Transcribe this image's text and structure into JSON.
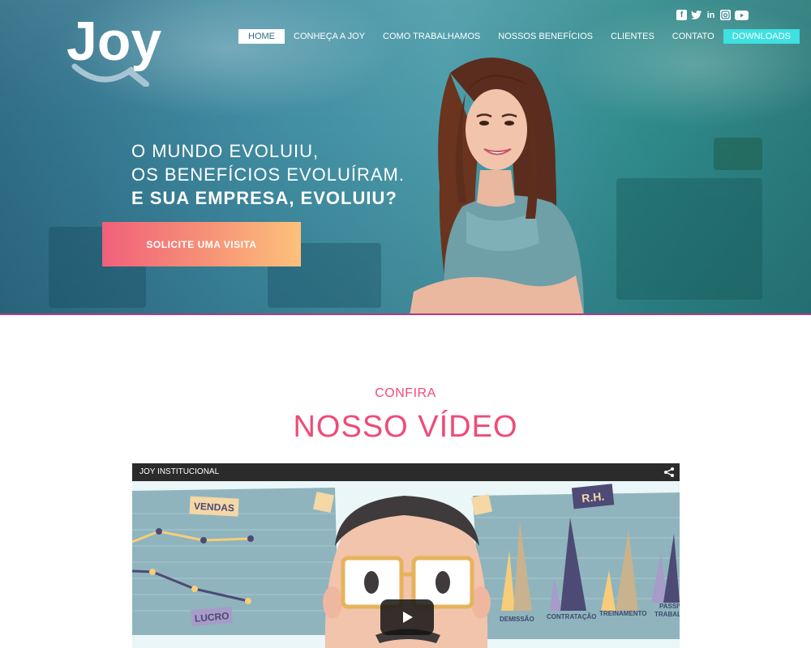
{
  "brand": {
    "logo_text": "Joy"
  },
  "nav": {
    "items": [
      {
        "label": "HOME"
      },
      {
        "label": "CONHEÇA A JOY"
      },
      {
        "label": "COMO TRABALHAMOS"
      },
      {
        "label": "NOSSOS BENEFÍCIOS"
      },
      {
        "label": "CLIENTES"
      },
      {
        "label": "CONTATO"
      },
      {
        "label": "DOWNLOADS"
      }
    ],
    "active": "HOME"
  },
  "social": {
    "icons": [
      "facebook-icon",
      "twitter-icon",
      "linkedin-icon",
      "instagram-icon",
      "youtube-icon"
    ]
  },
  "hero": {
    "line1": "O MUNDO EVOLUIU,",
    "line2": "OS BENEFÍCIOS EVOLUÍRAM.",
    "line3": "E SUA EMPRESA, EVOLUIU?",
    "cta_label": "SOLICITE UMA VISITA"
  },
  "section": {
    "kicker": "CONFIRA",
    "title": "NOSSO VÍDEO"
  },
  "video": {
    "title": "JOY INSTITUCIONAL",
    "art_labels": {
      "vendas": "VENDAS",
      "lucro": "LUCRO",
      "rh": "R.H.",
      "demissao": "DEMISSÃO",
      "contratacao": "CONTRATAÇÃO",
      "treinamento": "TREINAMENTO",
      "passivo": "PASSIVO",
      "trabalho": "TRABALHO"
    }
  },
  "colors": {
    "accent_pink": "#ef4b79",
    "cta_gradient_start": "#f0607a",
    "cta_gradient_end": "#fdc17a",
    "downloads_bg": "#3ee0e0",
    "hero_line": "#b03a86"
  }
}
